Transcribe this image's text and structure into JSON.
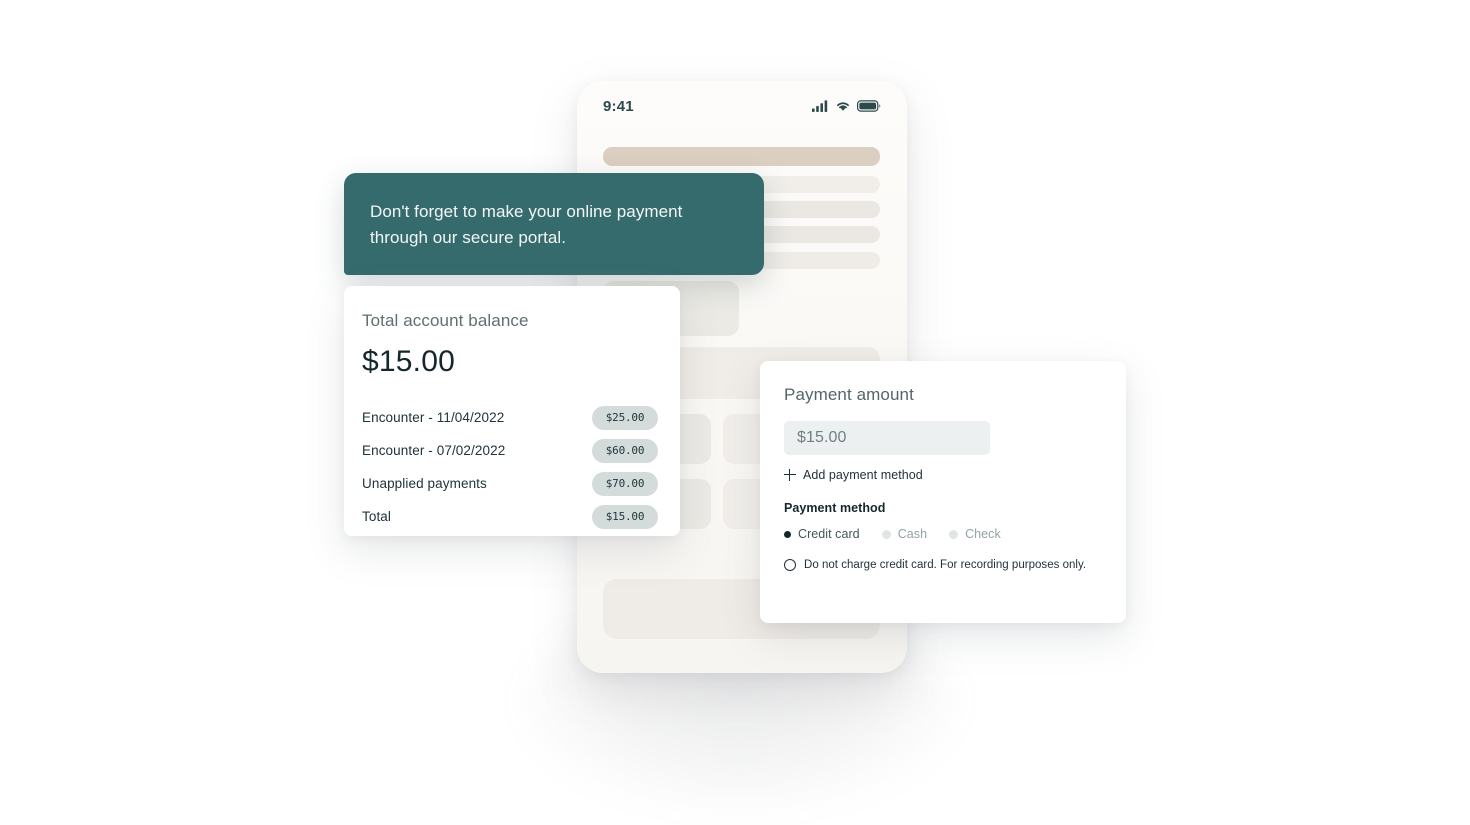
{
  "phone": {
    "status_bar": {
      "time": "9:41",
      "icons": [
        "cellular-signal-icon",
        "wifi-icon",
        "battery-icon"
      ]
    },
    "skeleton_placeholder": true
  },
  "tooltip": {
    "text": "Don't forget to make your online payment through our secure portal.",
    "background_color": "#366b6e",
    "text_color": "#f2f6f6"
  },
  "balance_card": {
    "title": "Total account balance",
    "amount": "$15.00",
    "rows": [
      {
        "label": "Encounter - 11/04/2022",
        "value": "$25.00"
      },
      {
        "label": "Encounter - 07/02/2022",
        "value": "$60.00"
      },
      {
        "label": "Unapplied payments",
        "value": "$70.00"
      },
      {
        "label": "Total",
        "value": "$15.00"
      }
    ],
    "pill_color": "#d3dcda"
  },
  "payment_card": {
    "title": "Payment amount",
    "amount_value": "$15.00",
    "amount_placeholder": "$15.00",
    "add_payment_method_label": "Add payment method",
    "payment_method_label": "Payment method",
    "methods": [
      {
        "label": "Credit card",
        "selected": true
      },
      {
        "label": "Cash",
        "selected": false
      },
      {
        "label": "Check",
        "selected": false
      }
    ],
    "do_not_charge": {
      "label": "Do not charge credit card. For recording purposes only.",
      "checked": false
    }
  },
  "theme": {
    "accent_teal": "#366b6e",
    "dark_text": "#14272c",
    "muted_text": "#5f7072",
    "canvas": "#ffffff"
  }
}
